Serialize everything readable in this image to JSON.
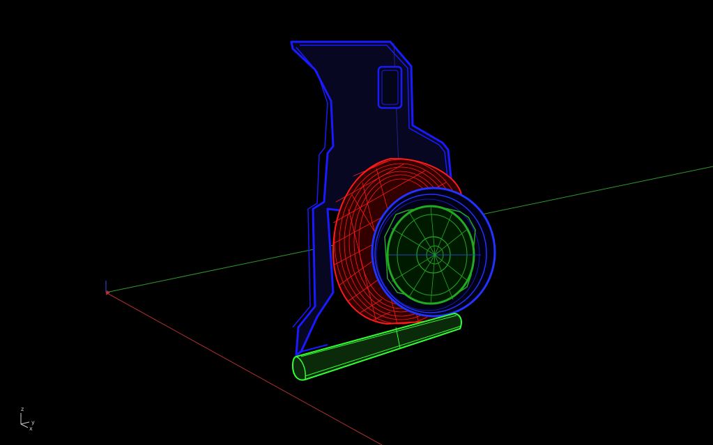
{
  "viewport": {
    "background": "#000000",
    "axis_colors": {
      "x": "#b03030",
      "y": "#2f9a2f",
      "z": "#3a3ad0"
    }
  },
  "corner_triad": {
    "z_label": "z",
    "y_label": "y",
    "x_label": "x",
    "color": "#d0d0d0"
  },
  "model": {
    "panel_color": "#1a1aff",
    "panel_fill": "#070722",
    "speaker_cup_color": "#ff1a1a",
    "speaker_ring_color": "#2233ff",
    "speaker_cone_color": "#22aa22",
    "base_bar_color": "#33ff33"
  }
}
